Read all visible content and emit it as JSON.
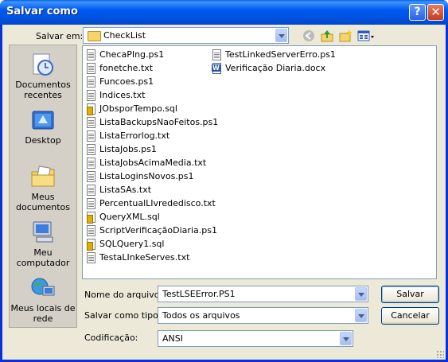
{
  "window": {
    "title": "Salvar como",
    "help_glyph": "?",
    "close_glyph": "✕"
  },
  "toolbar": {
    "save_in_label": "Salvar em:",
    "save_in_value": "CheckList",
    "icons": [
      "back-icon",
      "up-folder-icon",
      "new-folder-icon",
      "views-menu-icon"
    ]
  },
  "places": [
    {
      "label": "Documentos recentes",
      "icon": "recent-documents-icon"
    },
    {
      "label": "Desktop",
      "icon": "desktop-icon"
    },
    {
      "label": "Meus documentos",
      "icon": "my-documents-icon"
    },
    {
      "label": "Meu computador",
      "icon": "my-computer-icon"
    },
    {
      "label": "Meus locais de rede",
      "icon": "network-places-icon"
    }
  ],
  "files_col1": [
    {
      "name": "ChecaPIng.ps1",
      "type": "txt"
    },
    {
      "name": "fonetche.txt",
      "type": "txt"
    },
    {
      "name": "Funcoes.ps1",
      "type": "txt"
    },
    {
      "name": "Indices.txt",
      "type": "txt"
    },
    {
      "name": "JObsporTempo.sql",
      "type": "sql"
    },
    {
      "name": "ListaBackupsNaoFeitos.ps1",
      "type": "txt"
    },
    {
      "name": "ListaErrorlog.txt",
      "type": "txt"
    },
    {
      "name": "ListaJobs.ps1",
      "type": "txt"
    },
    {
      "name": "ListaJobsAcimaMedia.txt",
      "type": "txt"
    },
    {
      "name": "ListaLoginsNovos.ps1",
      "type": "txt"
    },
    {
      "name": "ListaSAs.txt",
      "type": "txt"
    },
    {
      "name": "PercentualLIvrededisco.txt",
      "type": "txt"
    },
    {
      "name": "QueryXML.sql",
      "type": "sql"
    },
    {
      "name": "ScriptVerificaçãoDiaria.ps1",
      "type": "txt"
    },
    {
      "name": "SQLQuery1.sql",
      "type": "sql"
    },
    {
      "name": "TestaLInkeServes.txt",
      "type": "txt"
    }
  ],
  "files_col2": [
    {
      "name": "TestLinkedServerErro.ps1",
      "type": "txt"
    },
    {
      "name": "Verificação Diaria.docx",
      "type": "doc"
    }
  ],
  "form": {
    "filename_label": "Nome do arquivo:",
    "filename_value": "TestLSEError.PS1",
    "type_label": "Salvar como tipo:",
    "type_value": "Todos os arquivos",
    "encoding_label": "Codificação:",
    "encoding_value": "ANSI"
  },
  "buttons": {
    "save": "Salvar",
    "cancel": "Cancelar"
  }
}
